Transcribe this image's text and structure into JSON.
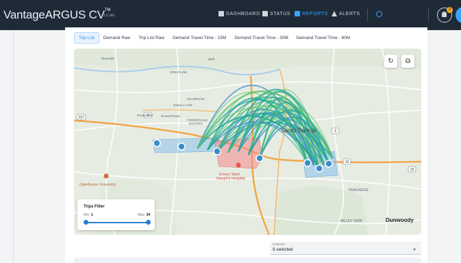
{
  "app": {
    "brand_prefix": "Vantage",
    "brand_name": "ARGUS CV",
    "brand_tm": "TM",
    "version": "v3.0.340"
  },
  "nav": {
    "dashboard": "DASHBOARD",
    "status": "STATUS",
    "reports": "REPORTS",
    "alerts": "ALERTS"
  },
  "notifications": {
    "count": "3"
  },
  "tabs": [
    {
      "label": "Trip List",
      "active": true
    },
    {
      "label": "Demand Raw",
      "active": false
    },
    {
      "label": "Trip List Raw",
      "active": false
    },
    {
      "label": "Demand Travel Time - 15M",
      "active": false
    },
    {
      "label": "Demand Travel Time - 30M",
      "active": false
    },
    {
      "label": "Demand Travel Time - 60M",
      "active": false
    }
  ],
  "map": {
    "labels": {
      "sandy_springs": "Sandy Springs",
      "dunwoody": "Dunwoody",
      "hospital_1": "Emory Saint",
      "hospital_2": "Joseph's Hospital",
      "university": "Oglethorpe University",
      "valley_view": "VALLEY VIEW",
      "trailridge": "TRAILRIDGE",
      "forestdale_1": "FORESTDALE",
      "forestdale_2": "ESTATES",
      "roswell_rd": "Roswell Rd",
      "roswell_road": "Roswell Road",
      "dalton": "Dalton Ln SW",
      "hillbrook": "HILLBROOK",
      "riverside": "Riverside",
      "crestline": "CRESTLINE",
      "bluff": "Bluff",
      "hwy_237": "237",
      "hwy_19a": "19",
      "hwy_19b": "19",
      "hwy_19c": "19",
      "hwy_9": "9"
    },
    "colors": {
      "arc_teal": "#1fa79a",
      "arc_green": "#5cc46a",
      "arc_blue": "#3a8ccd",
      "zone_blue": "#8cc3ea",
      "zone_red": "#f28a8a",
      "highway": "#f2a64a"
    }
  },
  "trips_filter": {
    "title": "Trips Filter",
    "min_label": "Min:",
    "min_value": "1",
    "max_label": "Max:",
    "max_value": "34"
  },
  "columns_select": {
    "label": "Columns",
    "value": "9 selected"
  }
}
